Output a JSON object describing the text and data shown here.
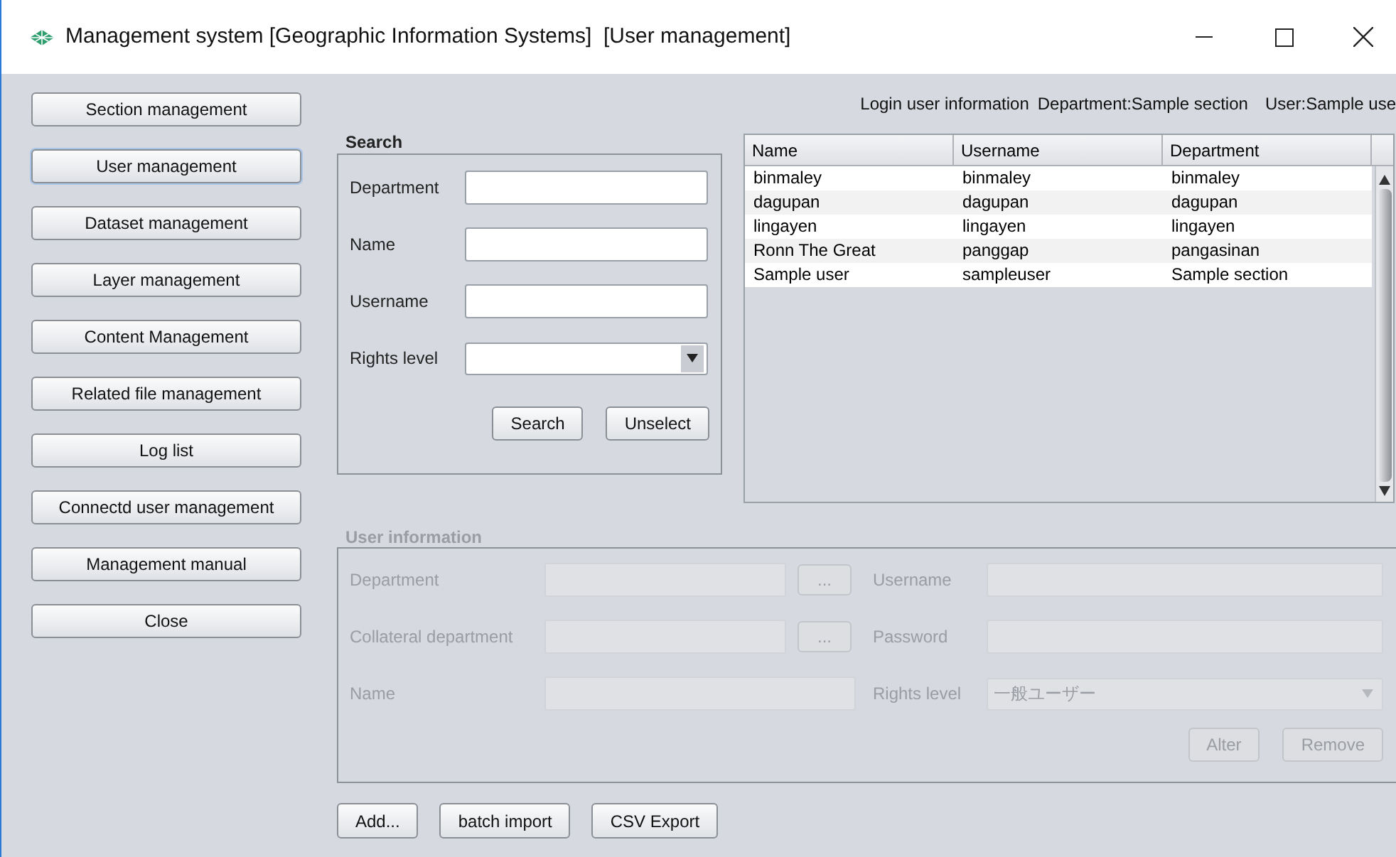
{
  "window": {
    "title": "Management system [Geographic Information Systems]  [User management]"
  },
  "sidebar": {
    "items": [
      {
        "label": "Section management",
        "selected": false
      },
      {
        "label": "User management",
        "selected": true
      },
      {
        "label": "Dataset management",
        "selected": false
      },
      {
        "label": "Layer management",
        "selected": false
      },
      {
        "label": "Content Management",
        "selected": false
      },
      {
        "label": "Related file management",
        "selected": false
      },
      {
        "label": "Log list",
        "selected": false
      },
      {
        "label": "Connectd user management",
        "selected": false
      },
      {
        "label": "Management manual",
        "selected": false
      },
      {
        "label": "Close",
        "selected": false
      }
    ]
  },
  "login_info": [
    "Login user information",
    "Department:Sample section",
    "User:Sample use"
  ],
  "search": {
    "title": "Search",
    "fields": [
      {
        "label": "Department",
        "kind": "text"
      },
      {
        "label": "Name",
        "kind": "text"
      },
      {
        "label": "Username",
        "kind": "text"
      },
      {
        "label": "Rights level",
        "kind": "select"
      }
    ],
    "buttons": [
      "Search",
      "Unselect"
    ]
  },
  "table": {
    "columns": [
      "Name",
      "Username",
      "Department"
    ],
    "rows": [
      [
        "binmaley",
        "binmaley",
        "binmaley"
      ],
      [
        "dagupan",
        "dagupan",
        "dagupan"
      ],
      [
        "lingayen",
        "lingayen",
        "lingayen"
      ],
      [
        "Ronn The Great",
        "panggap",
        "pangasinan"
      ],
      [
        "Sample user",
        "sampleuser",
        "Sample section"
      ]
    ]
  },
  "user_info": {
    "title": "User information",
    "disabled": true,
    "left": [
      {
        "label": "Department",
        "kind": "picker",
        "browse": "..."
      },
      {
        "label": "Collateral department",
        "kind": "picker",
        "browse": "..."
      },
      {
        "label": "Name",
        "kind": "text"
      }
    ],
    "right": [
      {
        "label": "Username",
        "kind": "text"
      },
      {
        "label": "Password",
        "kind": "text"
      },
      {
        "label": "Rights level",
        "kind": "select",
        "value": "一般ユーザー"
      }
    ],
    "buttons": [
      "Alter",
      "Remove"
    ]
  },
  "buttons": [
    "Add...",
    "batch import",
    "CSV Export"
  ]
}
